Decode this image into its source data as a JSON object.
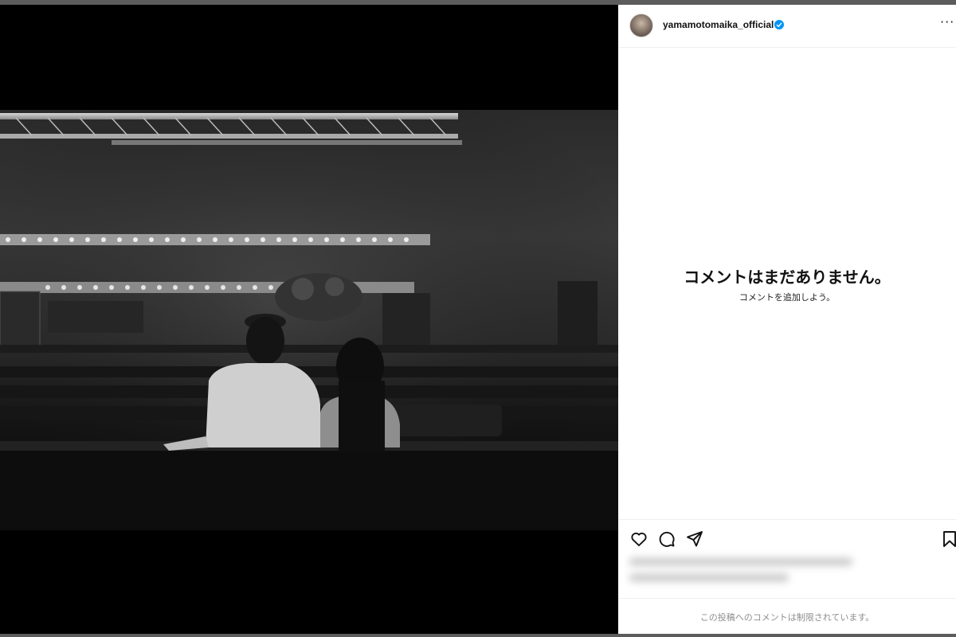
{
  "post": {
    "username": "yamamotomaika_official",
    "verified": true,
    "more_icon": "more-options-icon"
  },
  "comments": {
    "empty_title": "コメントはまだありません。",
    "empty_subtitle": "コメントを追加しよう。",
    "restricted_notice": "この投稿へのコメントは制限されています。"
  },
  "actions": {
    "icons": [
      "heart-icon",
      "comment-icon",
      "share-icon",
      "bookmark-icon"
    ]
  },
  "colors": {
    "verified_badge": "#0095f6",
    "muted_text": "#8e8e8e"
  }
}
